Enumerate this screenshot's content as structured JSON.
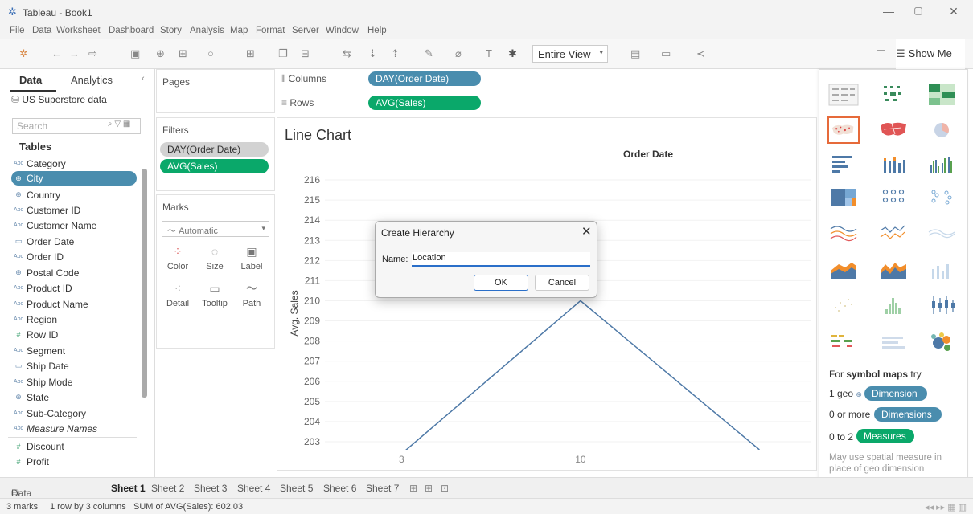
{
  "window": {
    "title": "Tableau - Book1"
  },
  "menu": [
    "File",
    "Data",
    "Worksheet",
    "Dashboard",
    "Story",
    "Analysis",
    "Map",
    "Format",
    "Server",
    "Window",
    "Help"
  ],
  "toolbar": {
    "fit_label": "Entire View",
    "show_me_label": "Show Me"
  },
  "data_pane": {
    "tab_data": "Data",
    "tab_analytics": "Analytics",
    "datasource": "US Superstore data",
    "search_placeholder": "Search",
    "tables_heading": "Tables",
    "fields": [
      {
        "label": "Category",
        "icon": "Abc"
      },
      {
        "label": "City",
        "icon": "geo"
      },
      {
        "label": "Country",
        "icon": "geo"
      },
      {
        "label": "Customer ID",
        "icon": "Abc"
      },
      {
        "label": "Customer Name",
        "icon": "Abc"
      },
      {
        "label": "Order Date",
        "icon": "date"
      },
      {
        "label": "Order ID",
        "icon": "Abc"
      },
      {
        "label": "Postal Code",
        "icon": "geo"
      },
      {
        "label": "Product ID",
        "icon": "Abc"
      },
      {
        "label": "Product Name",
        "icon": "Abc"
      },
      {
        "label": "Region",
        "icon": "Abc"
      },
      {
        "label": "Row ID",
        "icon": "num"
      },
      {
        "label": "Segment",
        "icon": "Abc"
      },
      {
        "label": "Ship Date",
        "icon": "date"
      },
      {
        "label": "Ship Mode",
        "icon": "Abc"
      },
      {
        "label": "State",
        "icon": "geo"
      },
      {
        "label": "Sub-Category",
        "icon": "Abc"
      },
      {
        "label": "Measure Names",
        "icon": "Abc"
      },
      {
        "label": "Discount",
        "icon": "num"
      },
      {
        "label": "Profit",
        "icon": "num"
      }
    ]
  },
  "pages": {
    "title": "Pages"
  },
  "filters": {
    "title": "Filters",
    "items": [
      "DAY(Order Date)",
      "AVG(Sales)"
    ]
  },
  "marks": {
    "title": "Marks",
    "type": "Automatic",
    "buttons": [
      "Color",
      "Size",
      "Label",
      "Detail",
      "Tooltip",
      "Path"
    ]
  },
  "shelves": {
    "columns_label": "Columns",
    "columns_pill": "DAY(Order Date)",
    "rows_label": "Rows",
    "rows_pill": "AVG(Sales)"
  },
  "sheet": {
    "title": "Line Chart"
  },
  "chart_data": {
    "type": "line",
    "title": "Order Date",
    "xlabel": "",
    "ylabel": "Avg. Sales",
    "x_ticks": [
      "3",
      "10"
    ],
    "y_ticks": [
      203,
      204,
      205,
      206,
      207,
      208,
      209,
      210,
      211,
      212,
      213,
      214,
      215,
      216
    ],
    "ylim": [
      202.6,
      216.8
    ],
    "series": [
      {
        "x": [
          3,
          10,
          17
        ],
        "values": [
          202.4,
          210.0,
          202.6
        ]
      }
    ],
    "xlim": [
      0,
      19
    ],
    "line_color": "#4e79a7"
  },
  "dialog": {
    "title": "Create Hierarchy",
    "name_label": "Name:",
    "name_value": "Location",
    "ok_label": "OK",
    "cancel_label": "Cancel"
  },
  "show_me": {
    "hint_heading_prefix": "For ",
    "hint_heading_bold": "symbol maps",
    "hint_heading_suffix": " try",
    "line1_prefix": "1 geo",
    "line1_pill": "Dimension",
    "line2_prefix": "0 or more",
    "line2_pill": "Dimensions",
    "line3_prefix": "0 to 2",
    "line3_pill": "Measures",
    "note": "May use spatial measure in place of geo dimension"
  },
  "sheet_tabs": {
    "data_source": "Data Source",
    "sheets": [
      "Sheet 1",
      "Sheet 2",
      "Sheet 3",
      "Sheet 4",
      "Sheet 5",
      "Sheet 6",
      "Sheet 7"
    ]
  },
  "status": {
    "marks": "3 marks",
    "dims": "1 row by 3 columns",
    "sum": "SUM of AVG(Sales): 602.03"
  },
  "colors": {
    "accent_blue": "#4a8dae",
    "measure_green": "#0aa86a",
    "selected_orange": "#e66a3a"
  }
}
